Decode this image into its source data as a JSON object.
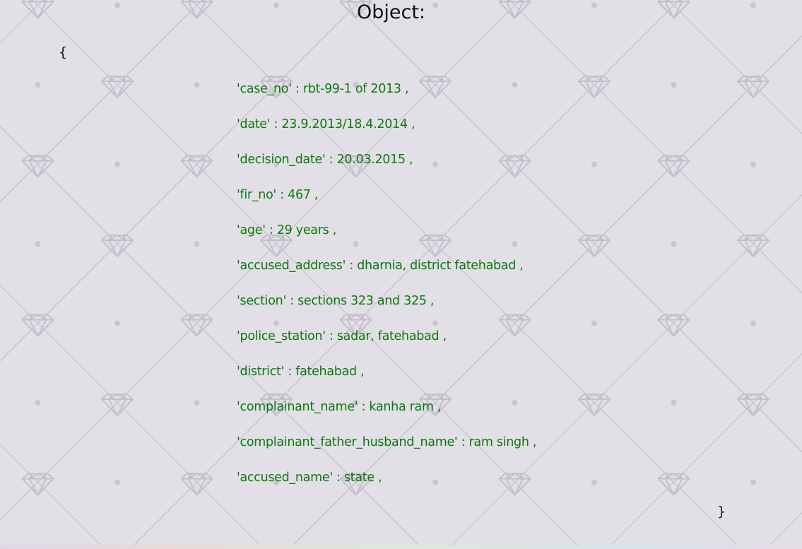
{
  "page": {
    "title": "Object:",
    "open_brace": "{",
    "close_brace": "}"
  },
  "colors": {
    "background": "#e2dfe6",
    "field_text": "#0b7a0b",
    "title_text": "#111111",
    "pattern": "#c4bfcc"
  },
  "fields": [
    {
      "key": "case_no",
      "value": "rbt-99-1 of 2013",
      "text": "'case_no' : rbt-99-1 of 2013 ,"
    },
    {
      "key": "date",
      "value": "23.9.2013/18.4.2014",
      "text": "'date' : 23.9.2013/18.4.2014 ,"
    },
    {
      "key": "decision_date",
      "value": "20.03.2015",
      "text": "'decision_date' : 20.03.2015 ,"
    },
    {
      "key": "fir_no",
      "value": "467",
      "text": "'fir_no' : 467 ,"
    },
    {
      "key": "age",
      "value": "29 years",
      "text": "'age' : 29 years ,"
    },
    {
      "key": "accused_address",
      "value": "dharnia, district fatehabad",
      "text": "'accused_address' : dharnia, district fatehabad ,"
    },
    {
      "key": "section",
      "value": "sections 323 and 325",
      "text": "'section' : sections 323 and 325 ,"
    },
    {
      "key": "police_station",
      "value": "sadar, fatehabad",
      "text": "'police_station' : sadar, fatehabad ,"
    },
    {
      "key": "district",
      "value": "fatehabad",
      "text": "'district' : fatehabad ,"
    },
    {
      "key": "complainant_name",
      "value": "kanha ram",
      "text": "'complainant_name' : kanha ram ,"
    },
    {
      "key": "complainant_father_husband_name",
      "value": "ram singh",
      "text": "'complainant_father_husband_name' : ram singh ,"
    },
    {
      "key": "accused_name",
      "value": "state",
      "text": "'accused_name' : state ,"
    }
  ]
}
